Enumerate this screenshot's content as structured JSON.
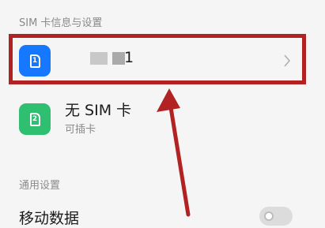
{
  "section_sim": {
    "title": "SIM 卡信息与设置"
  },
  "sim1": {
    "icon_number": "1",
    "name_visible": "1",
    "accent": "#1677ff"
  },
  "sim2": {
    "icon_number": "2",
    "title": "无 SIM 卡",
    "subtitle": "可插卡",
    "accent": "#2fbf71"
  },
  "section_general": {
    "title": "通用设置"
  },
  "mobile_data": {
    "label": "移动数据",
    "enabled": false
  },
  "annotation": {
    "highlight_color": "#b22222"
  }
}
